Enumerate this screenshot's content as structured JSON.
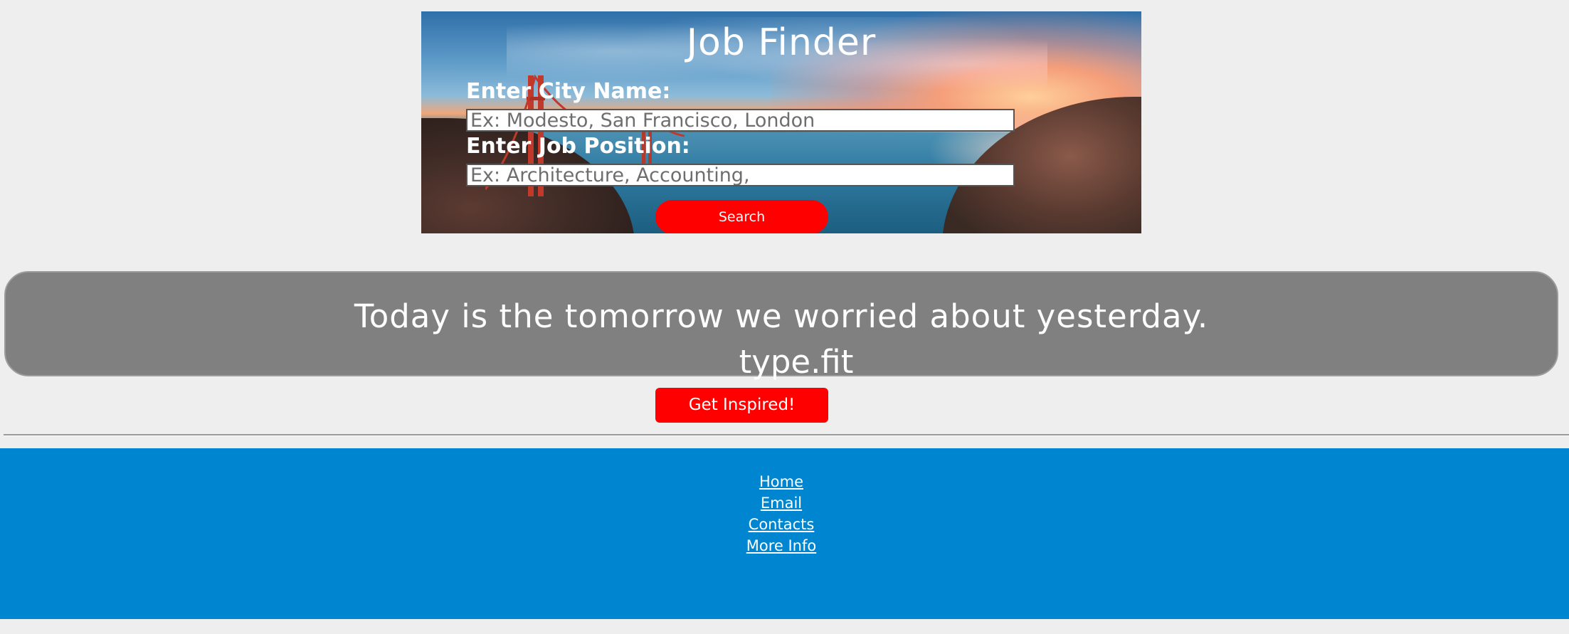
{
  "hero": {
    "title": "Job Finder",
    "city_label": "Enter City Name:",
    "city_placeholder": "Ex: Modesto, San Francisco, London",
    "city_value": "",
    "position_label": "Enter Job Position:",
    "position_placeholder": "Ex: Architecture, Accounting,",
    "position_value": "",
    "search_label": "Search"
  },
  "quote": {
    "text": "Today is the tomorrow we worried about yesterday.",
    "author": "type.fit",
    "button_label": "Get Inspired!"
  },
  "footer": {
    "links": [
      {
        "label": "Home"
      },
      {
        "label": "Email"
      },
      {
        "label": "Contacts"
      },
      {
        "label": "More Info"
      }
    ]
  },
  "colors": {
    "page_background": "#eeeeee",
    "accent_button": "#ff0000",
    "quote_background": "#808080",
    "footer_background": "#0085d0",
    "text_on_dark": "#ffffff"
  }
}
